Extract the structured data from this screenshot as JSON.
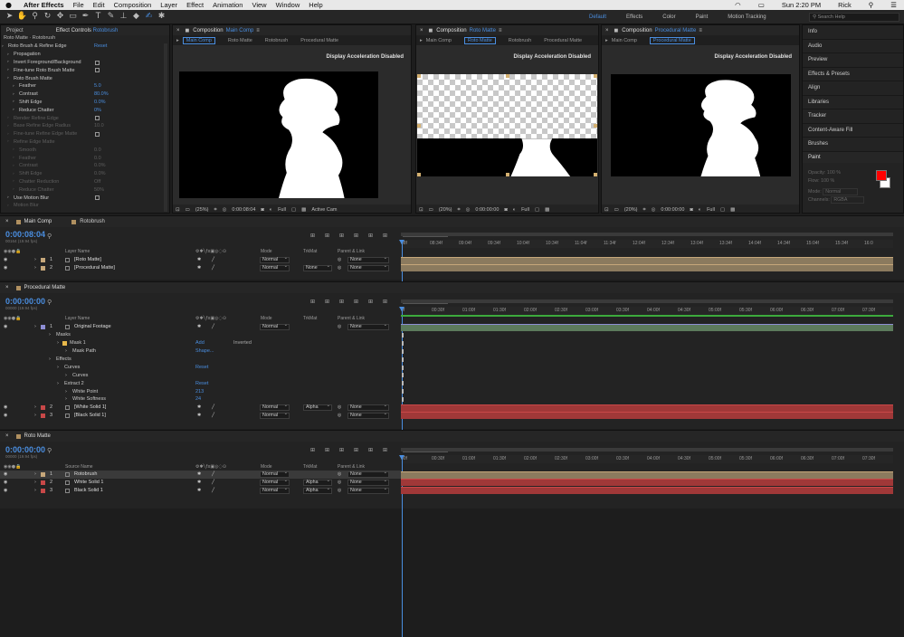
{
  "menubar": {
    "app": "After Effects",
    "items": [
      "File",
      "Edit",
      "Composition",
      "Layer",
      "Effect",
      "Animation",
      "View",
      "Window",
      "Help"
    ],
    "time": "Sun 2:20 PM",
    "user": "Rick"
  },
  "workspaces": {
    "items": [
      "Default",
      "Effects",
      "Color",
      "Paint",
      "Motion Tracking"
    ],
    "active": "Default",
    "search_placeholder": "Search Help"
  },
  "project_tab": "Project",
  "effect_controls": {
    "title": "Effect Controls",
    "layer": "Rotobrush",
    "header": "Roto Matte · Rotobrush",
    "rows": [
      {
        "label": "Roto Brush & Refine Edge",
        "value": "Reset",
        "indent": 0,
        "dim": false,
        "fx": true
      },
      {
        "label": "Propagation",
        "value": "",
        "indent": 1,
        "dim": false
      },
      {
        "label": "Invert Foreground/Background",
        "value": "",
        "indent": 1,
        "dim": false,
        "check": true
      },
      {
        "label": "Fine-tune Roto Brush Matte",
        "value": "",
        "indent": 1,
        "dim": false,
        "check": true
      },
      {
        "label": "Roto Brush Matte",
        "value": "",
        "indent": 1,
        "dim": false
      },
      {
        "label": "Feather",
        "value": "5.0",
        "indent": 2,
        "dim": false
      },
      {
        "label": "Contrast",
        "value": "80.0%",
        "indent": 2,
        "dim": false
      },
      {
        "label": "Shift Edge",
        "value": "0.0%",
        "indent": 2,
        "dim": false
      },
      {
        "label": "Reduce Chatter",
        "value": "0%",
        "indent": 2,
        "dim": false
      },
      {
        "label": "Render Refine Edge",
        "value": "",
        "indent": 1,
        "dim": true,
        "check": true
      },
      {
        "label": "Base Refine Edge Radius",
        "value": "10.0",
        "indent": 1,
        "dim": true
      },
      {
        "label": "Fine-tune Refine Edge Matte",
        "value": "",
        "indent": 1,
        "dim": true,
        "check": true
      },
      {
        "label": "Refine Edge Matte",
        "value": "",
        "indent": 1,
        "dim": true
      },
      {
        "label": "Smooth",
        "value": "0.0",
        "indent": 2,
        "dim": true
      },
      {
        "label": "Feather",
        "value": "0.0",
        "indent": 2,
        "dim": true
      },
      {
        "label": "Contrast",
        "value": "0.0%",
        "indent": 2,
        "dim": true
      },
      {
        "label": "Shift Edge",
        "value": "0.0%",
        "indent": 2,
        "dim": true
      },
      {
        "label": "Chatter Reduction",
        "value": "Off",
        "indent": 2,
        "dim": true
      },
      {
        "label": "Reduce Chatter",
        "value": "50%",
        "indent": 2,
        "dim": true
      },
      {
        "label": "Use Motion Blur",
        "value": "",
        "indent": 1,
        "dim": false,
        "check": true
      },
      {
        "label": "Motion Blur",
        "value": "",
        "indent": 1,
        "dim": true
      }
    ]
  },
  "viewers": [
    {
      "title": "Composition",
      "comp": "Main Comp",
      "crumbs": [
        "Main Comp",
        "Roto Matte",
        "Rotobrush",
        "Procedural Matte"
      ],
      "active": "Main Comp",
      "accel": "Display Acceleration Disabled",
      "zoom": "(25%)",
      "timecode": "0:00:08:04",
      "res": "Full",
      "extra": "Active Cam"
    },
    {
      "title": "Composition",
      "comp": "Roto Matte",
      "crumbs": [
        "Main Comp",
        "Roto Matte",
        "Rotobrush",
        "Procedural Matte"
      ],
      "active": "Roto Matte",
      "accel": "Display Acceleration Disabled",
      "zoom": "(20%)",
      "timecode": "0:00:00:00",
      "res": "Full",
      "extra": ""
    },
    {
      "title": "Composition",
      "comp": "Procedural Matte",
      "crumbs": [
        "Main Comp",
        "Procedural Matte"
      ],
      "active": "Procedural Matte",
      "accel": "Display Acceleration Disabled",
      "zoom": "(20%)",
      "timecode": "0:00:00:00",
      "res": "Full",
      "extra": ""
    }
  ],
  "right_panel": {
    "items": [
      "Info",
      "Audio",
      "Preview",
      "Effects & Presets",
      "Align",
      "Libraries",
      "Tracker",
      "Content-Aware Fill",
      "Brushes"
    ],
    "paint": {
      "title": "Paint",
      "opacity_label": "Opacity:",
      "opacity": "100 %",
      "flow_label": "Flow:",
      "flow": "100 %",
      "mode_label": "Mode:",
      "mode": "Normal",
      "channels_label": "Channels:",
      "channels": "RGBA",
      "fg_color": "#ff0000",
      "bg_color": "#ffffff"
    }
  },
  "timeline1": {
    "tabs": [
      "Main Comp",
      "Rotobrush"
    ],
    "timecode": "0:00:08:04",
    "sub": "00164 (19.94 fps)",
    "headers": {
      "name": "Layer Name",
      "mode": "Mode",
      "trkmat": "TrkMat",
      "parent": "Parent & Link"
    },
    "ruler": [
      "08f",
      "08:34f",
      "09:04f",
      "09:34f",
      "10:04f",
      "10:34f",
      "11:04f",
      "11:34f",
      "12:04f",
      "12:34f",
      "13:04f",
      "13:34f",
      "14:04f",
      "14:34f",
      "15:04f",
      "15:34f",
      "16:0"
    ],
    "layers": [
      {
        "num": "1",
        "name": "[Roto Matte]",
        "mode": "Normal",
        "trkmat": "",
        "parent": "None",
        "color": "#c6a77a",
        "track": "#8b7a5e"
      },
      {
        "num": "2",
        "name": "[Procedural Matte]",
        "mode": "Normal",
        "trkmat": "None",
        "parent": "None",
        "color": "#c6a77a",
        "track": "#8b7a5e"
      }
    ]
  },
  "timeline2": {
    "tabs": [
      "Procedural Matte"
    ],
    "timecode": "0:00:00:00",
    "sub": "00000 (19.94 fps)",
    "headers": {
      "name": "Layer Name",
      "mode": "Mode",
      "trkmat": "TrkMat",
      "parent": "Parent & Link"
    },
    "ruler": [
      "0f",
      "00:30f",
      "01:00f",
      "01:30f",
      "02:00f",
      "02:30f",
      "03:00f",
      "03:30f",
      "04:00f",
      "04:30f",
      "05:00f",
      "05:30f",
      "06:00f",
      "06:30f",
      "07:00f",
      "07:30f"
    ],
    "rows": [
      {
        "type": "layer",
        "num": "1",
        "name": "Original Footage",
        "mode": "Normal",
        "trkmat": "",
        "parent": "None",
        "color": "#8e8ed4"
      },
      {
        "type": "prop",
        "name": "Masks",
        "indent": 1
      },
      {
        "type": "prop",
        "name": "Mask 1",
        "indent": 2,
        "val": "Add",
        "extra": "Inverted",
        "swatch": "#e8b84a"
      },
      {
        "type": "prop",
        "name": "Mask Path",
        "indent": 3,
        "val": "Shape..."
      },
      {
        "type": "prop",
        "name": "Effects",
        "indent": 1
      },
      {
        "type": "prop",
        "name": "Curves",
        "indent": 2,
        "val": "Reset"
      },
      {
        "type": "prop",
        "name": "Curves",
        "indent": 3
      },
      {
        "type": "prop",
        "name": "Extract 2",
        "indent": 2,
        "val": "Reset"
      },
      {
        "type": "prop",
        "name": "White Point",
        "indent": 3,
        "val": "213"
      },
      {
        "type": "prop",
        "name": "White Softness",
        "indent": 3,
        "val": "24"
      },
      {
        "type": "layer",
        "num": "2",
        "name": "[White Solid 1]",
        "mode": "Normal",
        "trkmat": "Alpha",
        "parent": "None",
        "color": "#c84848"
      },
      {
        "type": "layer",
        "num": "3",
        "name": "[Black Solid 1]",
        "mode": "Normal",
        "trkmat": "",
        "parent": "None",
        "color": "#c84848"
      }
    ]
  },
  "timeline3": {
    "tabs": [
      "Roto Matte"
    ],
    "timecode": "0:00:00:00",
    "sub": "00000 (19.94 fps)",
    "headers": {
      "name": "Source Name",
      "mode": "Mode",
      "trkmat": "TrkMat",
      "parent": "Parent & Link"
    },
    "ruler": [
      "00f",
      "00:30f",
      "01:00f",
      "01:30f",
      "02:00f",
      "02:30f",
      "03:00f",
      "03:30f",
      "04:00f",
      "04:30f",
      "05:00f",
      "05:30f",
      "06:00f",
      "06:30f",
      "07:00f",
      "07:30f"
    ],
    "layers": [
      {
        "num": "1",
        "name": "Rotobrush",
        "mode": "Normal",
        "trkmat": "",
        "parent": "None",
        "color": "#c6a77a",
        "track": "#8b7a5e",
        "selected": true
      },
      {
        "num": "2",
        "name": "White Solid 1",
        "mode": "Normal",
        "trkmat": "Alpha",
        "parent": "None",
        "color": "#c84848",
        "track": "#a03838"
      },
      {
        "num": "3",
        "name": "Black Solid 1",
        "mode": "Normal",
        "trkmat": "Alpha",
        "parent": "None",
        "color": "#c84848",
        "track": "#a03838"
      }
    ]
  }
}
